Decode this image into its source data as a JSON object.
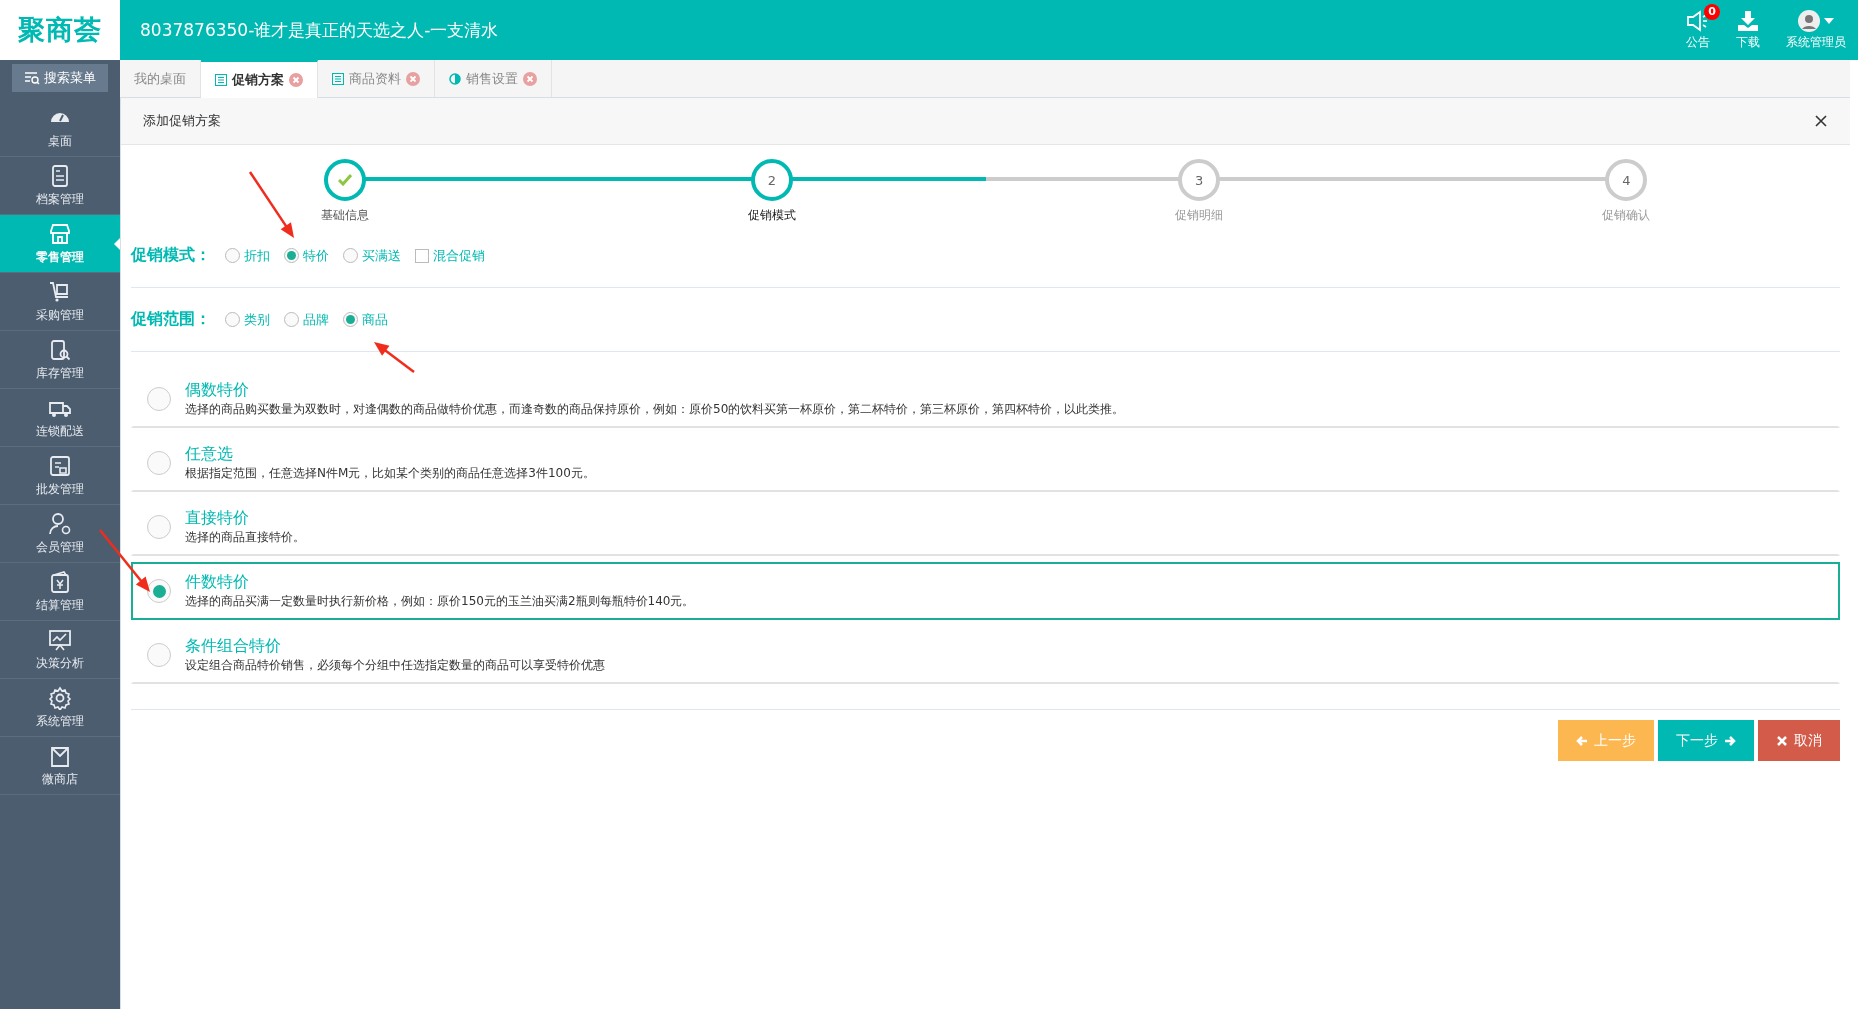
{
  "header": {
    "logo": "聚商荟",
    "title": "8037876350-谁才是真正的天选之人-一支清水",
    "tools": [
      {
        "kind": "notice",
        "label": "公告",
        "badge": "0"
      },
      {
        "kind": "download",
        "label": "下载"
      },
      {
        "kind": "user",
        "label": "系统管理员"
      }
    ]
  },
  "sidebar": {
    "search": "搜索菜单",
    "items": [
      {
        "label": "桌面",
        "selected": false
      },
      {
        "label": "档案管理",
        "selected": false
      },
      {
        "label": "零售管理",
        "selected": true
      },
      {
        "label": "采购管理",
        "selected": false
      },
      {
        "label": "库存管理",
        "selected": false
      },
      {
        "label": "连锁配送",
        "selected": false
      },
      {
        "label": "批发管理",
        "selected": false
      },
      {
        "label": "会员管理",
        "selected": false
      },
      {
        "label": "结算管理",
        "selected": false
      },
      {
        "label": "决策分析",
        "selected": false
      },
      {
        "label": "系统管理",
        "selected": false
      },
      {
        "label": "微商店",
        "selected": false
      }
    ]
  },
  "tabs": [
    {
      "label": "我的桌面",
      "selected": false,
      "kind": "home"
    },
    {
      "label": "促销方案",
      "selected": true,
      "kind": "list"
    },
    {
      "label": "商品资料",
      "selected": false,
      "kind": "list"
    },
    {
      "label": "销售设置",
      "selected": false,
      "kind": "half"
    }
  ],
  "panel": {
    "title": "添加促销方案",
    "steps": [
      {
        "label": "基础信息",
        "completed": true,
        "selected": false
      },
      {
        "number": "2",
        "label": "促销模式",
        "completed": false,
        "selected": true
      },
      {
        "number": "3",
        "label": "促销明细",
        "completed": false,
        "selected": false
      },
      {
        "number": "4",
        "label": "促销确认",
        "completed": false,
        "selected": false
      }
    ],
    "mode": {
      "label": "促销模式：",
      "options": [
        {
          "kind": "radio",
          "label": "折扣",
          "selected": false
        },
        {
          "kind": "radio",
          "label": "特价",
          "selected": true
        },
        {
          "kind": "radio",
          "label": "买满送",
          "selected": false
        },
        {
          "kind": "checkbox",
          "label": "混合促销",
          "checked": false
        }
      ]
    },
    "scope": {
      "label": "促销范围：",
      "options": [
        {
          "kind": "radio",
          "label": "类别",
          "selected": false
        },
        {
          "kind": "radio",
          "label": "品牌",
          "selected": false
        },
        {
          "kind": "radio",
          "label": "商品",
          "selected": true
        }
      ]
    },
    "choices": [
      {
        "title": "偶数特价",
        "description": "选择的商品购买数量为双数时，对逢偶数的商品做特价优惠，而逢奇数的商品保持原价，例如：原价50的饮料买第一杯原价，第二杯特价，第三杯原价，第四杯特价，以此类推。",
        "selected": false
      },
      {
        "title": "任意选",
        "description": "根据指定范围，任意选择N件M元，比如某个类别的商品任意选择3件100元。",
        "selected": false
      },
      {
        "title": "直接特价",
        "description": "选择的商品直接特价。",
        "selected": false
      },
      {
        "title": "件数特价",
        "description": "选择的商品买满一定数量时执行新价格，例如：原价150元的玉兰油买满2瓶则每瓶特价140元。",
        "selected": true
      },
      {
        "title": "条件组合特价",
        "description": "设定组合商品特价销售，必须每个分组中任选指定数量的商品可以享受特价优惠",
        "selected": false
      }
    ],
    "buttons": [
      {
        "kind": "prev",
        "label": "上一步"
      },
      {
        "kind": "next",
        "label": "下一步"
      },
      {
        "kind": "cancel",
        "label": "取消"
      }
    ]
  }
}
